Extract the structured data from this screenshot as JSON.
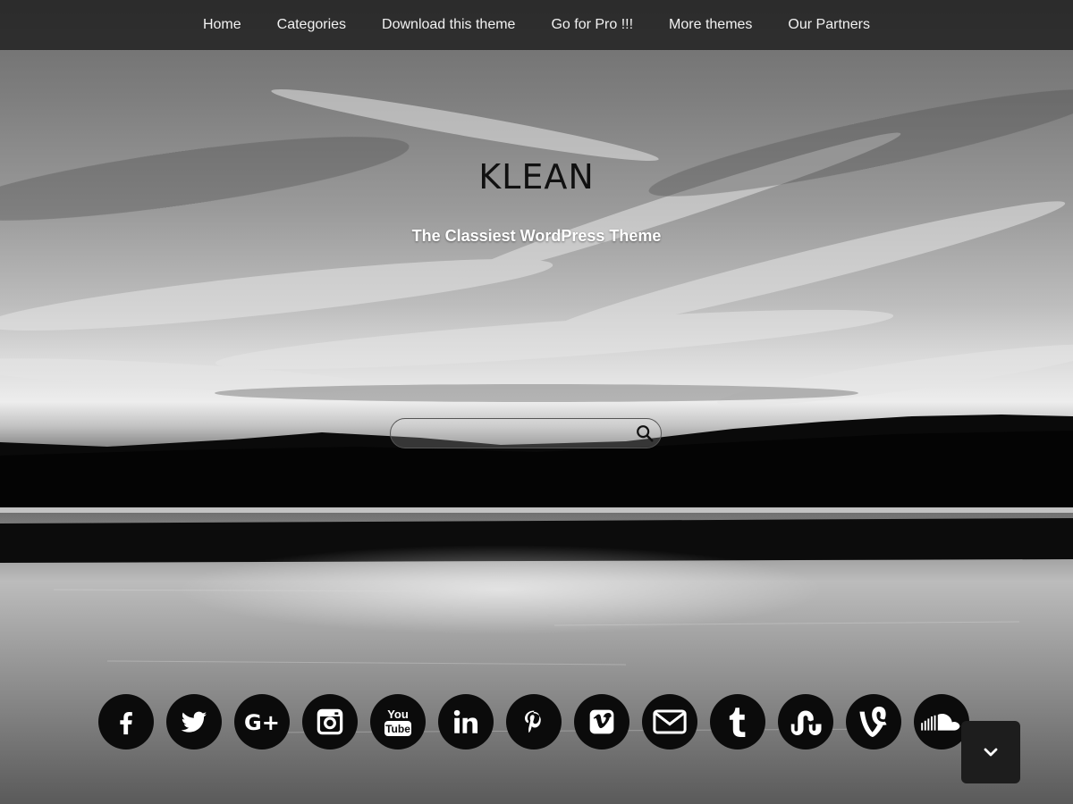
{
  "nav": {
    "items": [
      {
        "label": "Home"
      },
      {
        "label": "Categories"
      },
      {
        "label": "Download this theme"
      },
      {
        "label": "Go for Pro !!!"
      },
      {
        "label": "More themes"
      },
      {
        "label": "Our Partners"
      }
    ]
  },
  "header": {
    "title": "KLEAN",
    "tagline": "The Classiest WordPress Theme"
  },
  "search": {
    "value": "",
    "placeholder": "",
    "icon": "search-icon"
  },
  "social": [
    {
      "name": "facebook",
      "icon": "facebook-icon"
    },
    {
      "name": "twitter",
      "icon": "twitter-icon"
    },
    {
      "name": "google-plus",
      "icon": "google-plus-icon"
    },
    {
      "name": "instagram",
      "icon": "instagram-icon"
    },
    {
      "name": "youtube",
      "icon": "youtube-icon",
      "text_top": "You",
      "text_bottom": "Tube"
    },
    {
      "name": "linkedin",
      "icon": "linkedin-icon"
    },
    {
      "name": "pinterest",
      "icon": "pinterest-icon"
    },
    {
      "name": "vimeo",
      "icon": "vimeo-icon"
    },
    {
      "name": "email",
      "icon": "envelope-icon"
    },
    {
      "name": "tumblr",
      "icon": "tumblr-icon"
    },
    {
      "name": "stumbleupon",
      "icon": "stumbleupon-icon"
    },
    {
      "name": "vine",
      "icon": "vine-icon"
    },
    {
      "name": "soundcloud",
      "icon": "soundcloud-icon"
    }
  ],
  "scroll_button": {
    "icon": "chevron-down-icon"
  },
  "colors": {
    "nav_bg": "#141414",
    "icon_bg": "#0b0b0b",
    "icon_fg": "#ffffff"
  }
}
